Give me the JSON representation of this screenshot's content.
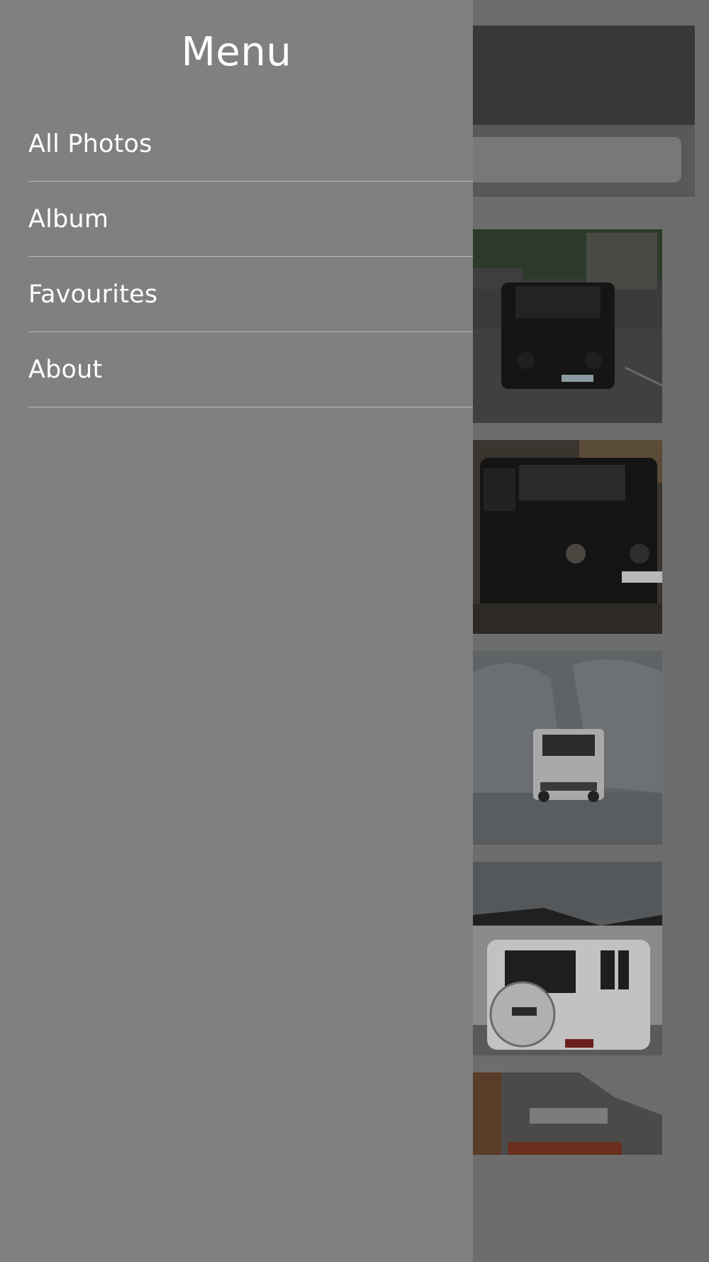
{
  "menu": {
    "title": "Menu",
    "items": [
      {
        "label": "All Photos"
      },
      {
        "label": "Album"
      },
      {
        "label": "Favourites"
      },
      {
        "label": "About"
      }
    ]
  },
  "gallery": {
    "photos": [
      {
        "subject": "black-suv-street"
      },
      {
        "subject": "black-suv-parking"
      },
      {
        "subject": "white-suv-snow"
      },
      {
        "subject": "white-suv-rear"
      },
      {
        "subject": "orange-suv-showroom"
      }
    ]
  },
  "colors": {
    "menu_background": "#808080",
    "overlay_background": "#6d6d6d",
    "menu_text": "#ffffff",
    "separator": "#b9b9b9"
  }
}
